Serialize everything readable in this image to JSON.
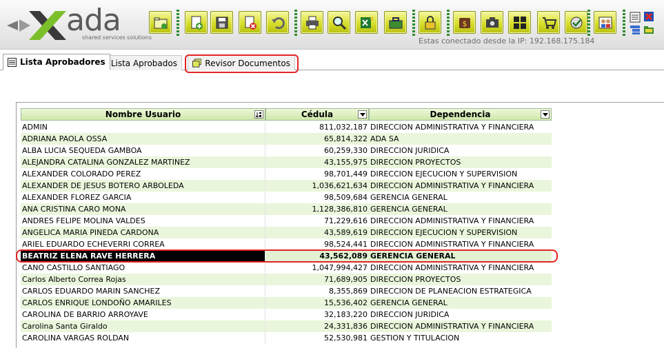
{
  "app": {
    "logo_text": "ada",
    "logo_tagline": "shared services solutions",
    "connection_status": "Estas conectado desde la IP: 192.168.175.184"
  },
  "toolbar": {
    "buttons": [
      {
        "icon": "folder-add-icon"
      },
      {
        "icon": "new-document-icon"
      },
      {
        "icon": "save-icon"
      },
      {
        "icon": "delete-icon"
      },
      {
        "icon": "undo-icon"
      },
      {
        "icon": "print-icon"
      },
      {
        "icon": "search-icon"
      },
      {
        "icon": "export-excel-icon"
      },
      {
        "icon": "toolbox-icon"
      },
      {
        "icon": "lock-icon"
      },
      {
        "icon": "money-icon"
      },
      {
        "icon": "camera-icon"
      },
      {
        "icon": "grid-icon"
      },
      {
        "icon": "cart-icon"
      },
      {
        "icon": "approve-icon"
      },
      {
        "icon": "users-icon"
      }
    ]
  },
  "tabs": [
    {
      "label": "Lista Aprobadores",
      "icon": "list-icon",
      "active": true
    },
    {
      "label": "Lista Aprobados",
      "icon": "page-icon",
      "active": false
    },
    {
      "label": "Revisor Documentos",
      "icon": "documents-icon",
      "active": false
    }
  ],
  "grid": {
    "columns": [
      "Nombre Usuario",
      "Cédula",
      "Dependencia"
    ],
    "rows": [
      {
        "name": "ADMIN",
        "cedula": "811,032,187",
        "dependencia": "DIRECCION ADMINISTRATIVA Y FINANCIERA"
      },
      {
        "name": "ADRIANA PAOLA OSSA",
        "cedula": "65,814,322",
        "dependencia": "ADA SA"
      },
      {
        "name": "ALBA LUCIA SEQUEDA GAMBOA",
        "cedula": "60,259,330",
        "dependencia": "DIRECCION JURIDICA"
      },
      {
        "name": "ALEJANDRA CATALINA GONZALEZ MARTINEZ",
        "cedula": "43,155,975",
        "dependencia": "DIRECCION PROYECTOS"
      },
      {
        "name": "ALEXANDER COLORADO PEREZ",
        "cedula": "98,701,449",
        "dependencia": "DIRECCION EJECUCION Y SUPERVISION"
      },
      {
        "name": "ALEXANDER DE JESUS BOTERO ARBOLEDA",
        "cedula": "1,036,621,634",
        "dependencia": "DIRECCION ADMINISTRATIVA Y FINANCIERA"
      },
      {
        "name": "ALEXANDER FLOREZ GARCIA",
        "cedula": "98,509,684",
        "dependencia": "GERENCIA GENERAL"
      },
      {
        "name": "ANA CRISTINA CARO MONA",
        "cedula": "1,128,386,810",
        "dependencia": "GERENCIA GENERAL"
      },
      {
        "name": "ANDRES FELIPE MOLINA VALDES",
        "cedula": "71,229,616",
        "dependencia": "DIRECCION ADMINISTRATIVA Y FINANCIERA"
      },
      {
        "name": "ANGELICA MARIA PINEDA CARDONA",
        "cedula": "43,589,619",
        "dependencia": "DIRECCION EJECUCION Y SUPERVISION"
      },
      {
        "name": "ARIEL EDUARDO ECHEVERRI CORREA",
        "cedula": "98,524,441",
        "dependencia": "DIRECCION ADMINISTRATIVA Y FINANCIERA"
      },
      {
        "name": "BEATRIZ ELENA RAVE HERRERA",
        "cedula": "43,562,089",
        "dependencia": "GERENCIA GENERAL",
        "selected": true
      },
      {
        "name": "CANO CASTILLO SANTIAGO",
        "cedula": "1,047,994,427",
        "dependencia": "DIRECCION ADMINISTRATIVA Y FINANCIERA"
      },
      {
        "name": "Carlos Alberto Correa Rojas",
        "cedula": "71,689,905",
        "dependencia": "DIRECCION PROYECTOS"
      },
      {
        "name": "CARLOS EDUARDO MARIN SANCHEZ",
        "cedula": "8,355,869",
        "dependencia": "DIRECCION DE PLANEACION ESTRATEGICA"
      },
      {
        "name": "CARLOS ENRIQUE LONDOÑO AMARILES",
        "cedula": "15,536,402",
        "dependencia": "GERENCIA GENERAL"
      },
      {
        "name": "CAROLINA DE BARRIO ARROYAVE",
        "cedula": "32,183,220",
        "dependencia": "DIRECCION JURIDICA"
      },
      {
        "name": "Carolina Santa Giraldo",
        "cedula": "24,331,836",
        "dependencia": "DIRECCION ADMINISTRATIVA Y FINANCIERA"
      },
      {
        "name": "CAROLINA VARGAS ROLDAN",
        "cedula": "52,530,981",
        "dependencia": "GESTION Y TITULACION"
      }
    ]
  },
  "colors": {
    "accent_green": "#c7d121",
    "highlight_red": "#e32424",
    "row_alt": "#eaf6dc"
  }
}
